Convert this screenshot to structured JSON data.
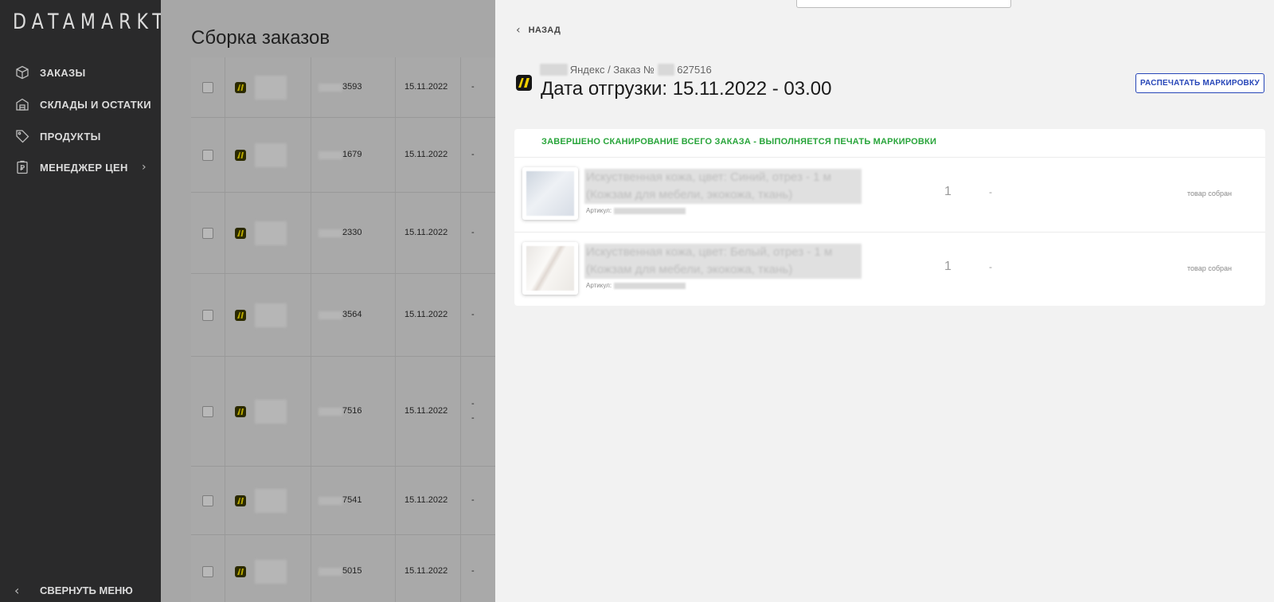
{
  "app": {
    "logo": "DATAMARKT"
  },
  "sidebar": {
    "items": [
      {
        "label": "ЗАКАЗЫ",
        "icon": "box-icon"
      },
      {
        "label": "СКЛАДЫ И ОСТАТКИ",
        "icon": "warehouse-icon"
      },
      {
        "label": "ПРОДУКТЫ",
        "icon": "tag-icon"
      },
      {
        "label": "МЕНЕДЖЕР ЦЕН",
        "icon": "price-list-icon"
      }
    ],
    "collapse_label": "СВЕРНУТЬ МЕНЮ"
  },
  "main": {
    "title": "Сборка заказов",
    "rows": [
      {
        "number": "3593",
        "date": "15.11.2022",
        "extra": "-"
      },
      {
        "number": "1679",
        "date": "15.11.2022",
        "extra": "-"
      },
      {
        "number": "2330",
        "date": "15.11.2022",
        "extra": "-"
      },
      {
        "number": "3564",
        "date": "15.11.2022",
        "extra": "-"
      },
      {
        "number": "7516",
        "date": "15.11.2022",
        "extra": "-",
        "extra2": "-"
      },
      {
        "number": "7541",
        "date": "15.11.2022",
        "extra": "-"
      },
      {
        "number": "5015",
        "date": "15.11.2022",
        "extra": "-"
      }
    ]
  },
  "drawer": {
    "back_label": "НАЗАД",
    "marketplace": "Яндекс",
    "order_prefix": "/ Заказ №",
    "order_number_suffix": "627516",
    "ship_date": "Дата отгрузки: 15.11.2022 - 03.00",
    "print_button": "РАСПЕЧАТАТЬ МАРКИРОВКУ",
    "status_message": "ЗАВЕРШЕНО СКАНИРОВАНИЕ ВСЕГО ЗАКАЗА - ВЫПОЛНЯЕТСЯ ПЕЧАТЬ МАРКИРОВКИ",
    "items": [
      {
        "name": "Искуственная кожа, цвет: Синий, отрез - 1 м (Кожзам для мебели, экокожа, ткань)",
        "sku_label": "Артикул:",
        "qty": "1",
        "dash": "-",
        "status": "товар собран"
      },
      {
        "name": "Искуственная кожа, цвет: Белый, отрез - 1 м (Кожзам для мебели, экокожа, ткань)",
        "sku_label": "Артикул:",
        "qty": "1",
        "dash": "-",
        "status": "товар собран"
      }
    ]
  },
  "colors": {
    "sidebar_bg": "#2a2a2b",
    "drawer_bg": "#f2f2f2",
    "accent_blue": "#2746b8",
    "success_green": "#29a53b",
    "yandex_yellow": "#f2cf00"
  }
}
